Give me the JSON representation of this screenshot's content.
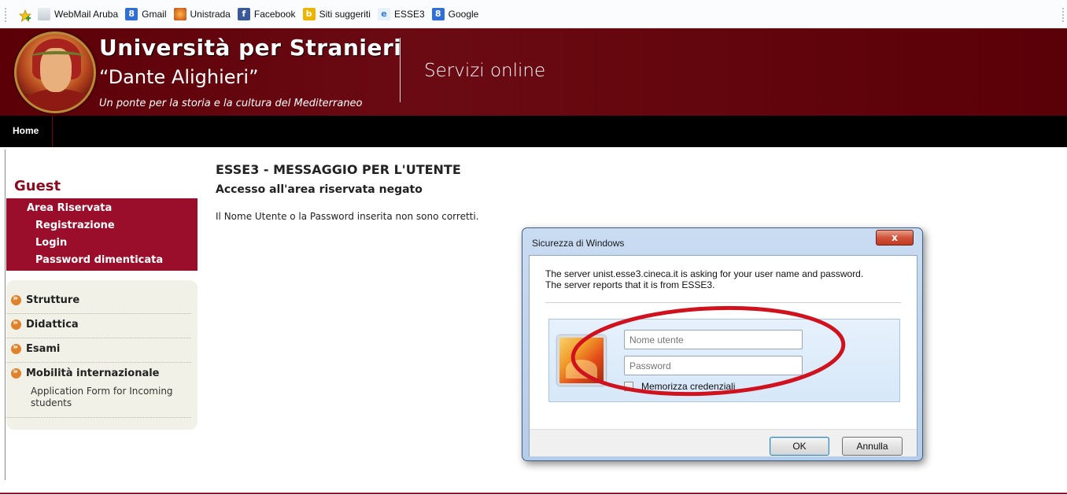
{
  "favorites_bar": {
    "items": [
      {
        "label": "WebMail Aruba",
        "icon": "aruba-icon"
      },
      {
        "label": "Gmail",
        "icon": "google-icon"
      },
      {
        "label": "Unistrada",
        "icon": "unistrada-icon"
      },
      {
        "label": "Facebook",
        "icon": "facebook-icon"
      },
      {
        "label": "Siti suggeriti",
        "icon": "bing-icon"
      },
      {
        "label": "ESSE3",
        "icon": "ie-icon"
      },
      {
        "label": "Google",
        "icon": "google-icon"
      }
    ]
  },
  "header": {
    "title": "Università per Stranieri",
    "subtitle": "“Dante Alighieri”",
    "motto": "Un ponte per la storia e la cultura del Mediterraneo",
    "section": "Servizi online"
  },
  "nav": {
    "home": "Home"
  },
  "sidebar": {
    "heading": "Guest",
    "area_title": "Area Riservata",
    "area_items": [
      "Registrazione",
      "Login",
      "Password dimenticata"
    ],
    "menu": [
      "Strutture",
      "Didattica",
      "Esami",
      "Mobilità internazionale"
    ],
    "submenu": "Application Form for Incoming students"
  },
  "main": {
    "title": "ESSE3 - MESSAGGIO PER L'UTENTE",
    "subtitle": "Accesso all'area riservata negato",
    "message": "Il Nome Utente o la Password inserita non sono corretti."
  },
  "dialog": {
    "title": "Sicurezza di Windows",
    "close_label": "x",
    "text_line1": "The server unist.esse3.cineca.it is asking for your user name and password.",
    "text_line2": "The server reports that it is from ESSE3.",
    "username_placeholder": "Nome utente",
    "password_placeholder": "Password",
    "remember_label": "Memorizza credenziali",
    "ok_label": "OK",
    "cancel_label": "Annulla"
  },
  "colors": {
    "header_bg": "#5c0008",
    "sidebar_red": "#9b0e2b",
    "guest_text": "#8b0b1f",
    "annotation": "#d0121e"
  }
}
